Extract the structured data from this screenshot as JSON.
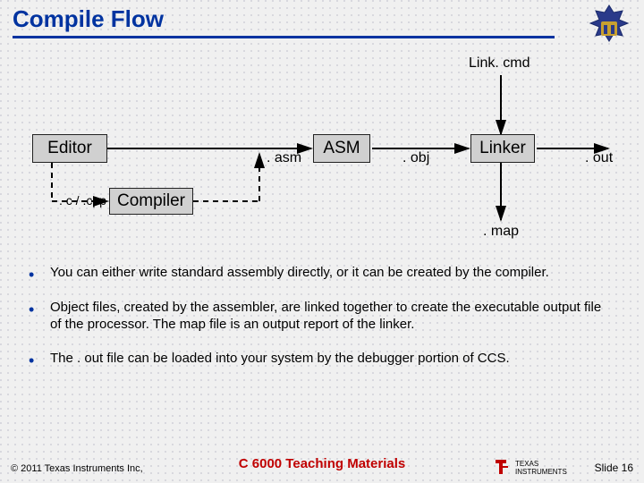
{
  "title": "Compile Flow",
  "diagram": {
    "nodes": {
      "editor": "Editor",
      "compiler": "Compiler",
      "asm": "ASM",
      "linker": "Linker"
    },
    "labels": {
      "link_cmd": "Link. cmd",
      "c_cpp": ". c / .cpp",
      "asm_ext": ". asm",
      "obj_ext": ". obj",
      "out_ext": ". out",
      "map_ext": ". map"
    },
    "edges": [
      {
        "from": "editor",
        "to": "asm",
        "style": "solid"
      },
      {
        "from": "editor",
        "to": "compiler",
        "via": ".c / .cpp",
        "style": "dashed"
      },
      {
        "from": "compiler",
        "to": "asm-input",
        "via": ".asm",
        "style": "dashed"
      },
      {
        "from": "asm",
        "to": "linker",
        "via": ".obj",
        "style": "solid"
      },
      {
        "from": "link.cmd",
        "to": "linker",
        "style": "solid"
      },
      {
        "from": "linker",
        "to": ".out",
        "style": "solid"
      },
      {
        "from": "linker",
        "to": ".map",
        "style": "solid"
      }
    ]
  },
  "bullets": [
    "You can either write standard assembly directly, or it can be created by the compiler.",
    "Object files, created by the assembler, are linked together to create the executable output file of the processor. The map file is an output report of the linker.",
    "The . out file can be loaded into your system by the debugger portion of CCS."
  ],
  "footer": {
    "copyright": "© 2011 Texas Instruments Inc,",
    "center": "C 6000 Teaching Materials",
    "slide": "Slide 16"
  }
}
